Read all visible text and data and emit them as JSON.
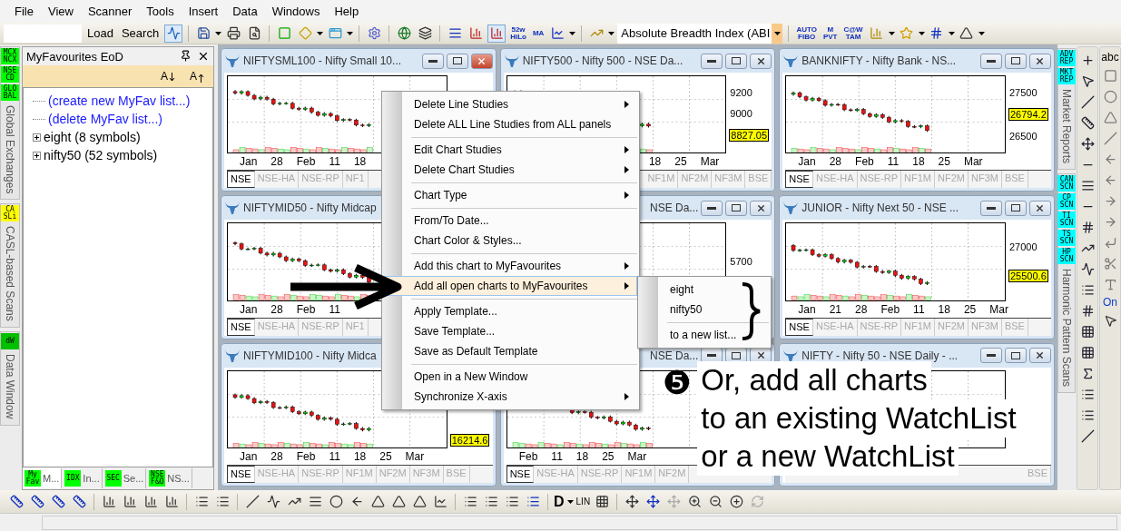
{
  "menu_bar": [
    "File",
    "View",
    "Scanner",
    "Tools",
    "Insert",
    "Data",
    "Windows",
    "Help"
  ],
  "toolbar": {
    "buttons": [
      "Load",
      "Search"
    ],
    "text_icons": [
      {
        "lines": [
          "52w",
          "HiLo"
        ]
      },
      {
        "lines": [
          "MA"
        ]
      },
      {
        "lines": [
          "AUTO",
          "FIBO"
        ]
      },
      {
        "lines": [
          "M",
          "PVT"
        ]
      },
      {
        "lines": [
          "C@W",
          "TAM"
        ]
      }
    ],
    "indicator": "Absolute Breadth Index (ABI"
  },
  "left_strip": [
    {
      "badges": [
        {
          "lines": [
            "MCX",
            "NCX"
          ],
          "color": "#00ff00"
        },
        {
          "lines": [
            "NSE",
            "CD"
          ],
          "color": "#00ff00"
        },
        {
          "lines": [
            "GLO",
            "BAL"
          ],
          "color": "#00ff00"
        }
      ],
      "label": "Global Exchanges"
    },
    {
      "badges": [
        {
          "lines": [
            "CA",
            "SLi"
          ],
          "color": "#ffff00"
        }
      ],
      "label": "CASL-based Scans"
    },
    {
      "badges": [
        {
          "lines": [
            "dW"
          ],
          "color": "#00c000"
        }
      ],
      "label": "Data Window"
    }
  ],
  "favourites_panel": {
    "title": "MyFavourites EoD",
    "sort_buttons": [
      "A",
      "A"
    ],
    "tree": [
      {
        "label": "(create new MyFav list...)",
        "kind": "link"
      },
      {
        "label": "(delete MyFav list...)",
        "kind": "link"
      },
      {
        "label": "eight (8 symbols)",
        "kind": "folder",
        "expanded": false
      },
      {
        "label": "nifty50 (52 symbols)",
        "kind": "folder",
        "expanded": false
      }
    ],
    "tabs": [
      {
        "badge": [
          "My",
          "Fav"
        ],
        "label": "M...",
        "selected": true
      },
      {
        "badge": [
          "IDX"
        ],
        "label": "In...",
        "selected": false
      },
      {
        "badge": [
          "SEC"
        ],
        "label": "Se...",
        "selected": false
      },
      {
        "badge": [
          "NSE",
          "F&O"
        ],
        "label": "NS...",
        "selected": false
      }
    ]
  },
  "charts": [
    {
      "title": "NIFTYSML100 - Nifty Small 10...",
      "active": true,
      "x_labels": [
        "Jan",
        "28",
        "Feb",
        "11",
        "18"
      ],
      "tabs": [
        {
          "label": "NSE",
          "selected": true
        },
        {
          "label": "NSE-HA",
          "selected": false
        },
        {
          "label": "NSE-RP",
          "selected": false
        },
        {
          "label": "NF1",
          "selected": false
        }
      ]
    },
    {
      "title": "NIFTY500 - Nifty 500 - NSE Da...",
      "active": false,
      "x_labels": [
        "18",
        "25",
        "Mar"
      ],
      "axis_cut_left": true,
      "y_labels": [
        {
          "text": "9200",
          "kind": "tick"
        },
        {
          "text": "9000",
          "kind": "tick"
        },
        {
          "text": "8827.05",
          "kind": "last"
        }
      ],
      "tabs": [
        {
          "label": "NF1M",
          "selected": false
        },
        {
          "label": "NF2M",
          "selected": false
        },
        {
          "label": "NF3M",
          "selected": false
        },
        {
          "label": "BSE",
          "selected": false
        }
      ],
      "tabs_cut_left": true
    },
    {
      "title": "BANKNIFTY - Nifty Bank - NS...",
      "active": false,
      "x_labels": [
        "Jan",
        "28",
        "Feb",
        "11",
        "18",
        "25",
        "Mar"
      ],
      "y_labels": [
        {
          "text": "27500",
          "kind": "tick"
        },
        {
          "text": "26794.2",
          "kind": "last"
        },
        {
          "text": "26500",
          "kind": "tick"
        }
      ],
      "tabs": [
        {
          "label": "NSE",
          "selected": true
        },
        {
          "label": "NSE-HA",
          "selected": false
        },
        {
          "label": "NSE-RP",
          "selected": false
        },
        {
          "label": "NF1M",
          "selected": false
        },
        {
          "label": "NF2M",
          "selected": false
        },
        {
          "label": "NF3M",
          "selected": false
        },
        {
          "label": "BSE",
          "selected": false
        }
      ]
    },
    {
      "title": "NIFTYMID50 - Nifty Midcap",
      "active": false,
      "x_labels": [
        "Jan",
        "28",
        "Feb",
        "11"
      ],
      "tabs": [
        {
          "label": "NSE",
          "selected": true
        },
        {
          "label": "NSE-HA",
          "selected": false
        },
        {
          "label": "NSE-RP",
          "selected": false
        },
        {
          "label": "NF1",
          "selected": false
        }
      ]
    },
    {
      "title": "NSE Da...",
      "title_cut_left": true,
      "active": false,
      "y_labels": [
        {
          "text": "5700",
          "kind": "tick"
        }
      ]
    },
    {
      "title": "JUNIOR - Nifty Next 50 - NSE ...",
      "active": false,
      "x_labels": [
        "Jan",
        "21",
        "28",
        "Feb",
        "11",
        "18",
        "25",
        "Mar"
      ],
      "y_labels": [
        {
          "text": "27000",
          "kind": "tick"
        },
        {
          "text": "25500.6",
          "kind": "last"
        }
      ],
      "tabs": [
        {
          "label": "NSE",
          "selected": true
        },
        {
          "label": "NSE-HA",
          "selected": false
        },
        {
          "label": "NSE-RP",
          "selected": false
        },
        {
          "label": "NF1M",
          "selected": false
        },
        {
          "label": "NF2M",
          "selected": false
        },
        {
          "label": "NF3M",
          "selected": false
        },
        {
          "label": "BSE",
          "selected": false
        }
      ]
    },
    {
      "title": "NIFTYMID100 - Nifty Midca",
      "active": false,
      "x_labels": [
        "Jan",
        "28",
        "Feb",
        "11",
        "18",
        "25",
        "Mar"
      ],
      "y_labels": [
        {
          "text": "16214.6",
          "kind": "last"
        }
      ],
      "tabs": [
        {
          "label": "NSE",
          "selected": true
        },
        {
          "label": "NSE-HA",
          "selected": false
        },
        {
          "label": "NSE-RP",
          "selected": false
        },
        {
          "label": "NF1M",
          "selected": false
        },
        {
          "label": "NF2M",
          "selected": false
        },
        {
          "label": "NF3M",
          "selected": false
        },
        {
          "label": "BSE",
          "selected": false
        }
      ]
    },
    {
      "title": "NSE Da...",
      "title_cut_left": true,
      "active": false,
      "x_labels": [
        "Feb",
        "11",
        "18",
        "25",
        "Mar"
      ],
      "tabs": [
        {
          "label": "NSE",
          "selected": true
        },
        {
          "label": "NSE-HA",
          "selected": false
        },
        {
          "label": "NSE-RP",
          "selected": false
        },
        {
          "label": "NF1M",
          "selected": false
        },
        {
          "label": "NF2M",
          "selected": false
        }
      ]
    },
    {
      "title": "NIFTY - Nifty 50 - NSE Daily - ...",
      "active": false,
      "tabs": [
        {
          "label": "BSE",
          "selected": false
        }
      ],
      "tabs_cut_left": true
    }
  ],
  "context_menu": [
    {
      "kind": "item",
      "label": "Delete Line Studies",
      "submenu": true,
      "selected": false
    },
    {
      "kind": "item",
      "label": "Delete ALL Line Studies from ALL panels",
      "submenu": false,
      "selected": false
    },
    {
      "kind": "separator"
    },
    {
      "kind": "item",
      "label": "Edit Chart Studies",
      "submenu": true,
      "selected": false
    },
    {
      "kind": "item",
      "label": "Delete Chart Studies",
      "submenu": true,
      "selected": false
    },
    {
      "kind": "separator"
    },
    {
      "kind": "item",
      "label": "Chart Type",
      "submenu": true,
      "selected": false
    },
    {
      "kind": "separator"
    },
    {
      "kind": "item",
      "label": "From/To Date...",
      "submenu": false,
      "selected": false
    },
    {
      "kind": "item",
      "label": "Chart Color & Styles...",
      "submenu": false,
      "selected": false
    },
    {
      "kind": "separator"
    },
    {
      "kind": "item",
      "label": "Add this chart to MyFavourites",
      "submenu": true,
      "selected": false
    },
    {
      "kind": "item",
      "label": "Add all open charts to MyFavourites",
      "submenu": true,
      "selected": true
    },
    {
      "kind": "separator"
    },
    {
      "kind": "item",
      "label": "Apply Template...",
      "submenu": false,
      "selected": false
    },
    {
      "kind": "item",
      "label": "Save Template...",
      "submenu": false,
      "selected": false
    },
    {
      "kind": "item",
      "label": "Save as Default Template",
      "submenu": false,
      "selected": false
    },
    {
      "kind": "separator"
    },
    {
      "kind": "item",
      "label": "Open in a New Window",
      "submenu": false,
      "selected": false
    },
    {
      "kind": "item",
      "label": "Synchronize X-axis",
      "submenu": true,
      "selected": false
    }
  ],
  "submenu": [
    {
      "kind": "item",
      "label": "eight",
      "selected": false
    },
    {
      "kind": "item",
      "label": "nifty50",
      "selected": false
    },
    {
      "kind": "separator"
    },
    {
      "kind": "item",
      "label": "to a new list...",
      "selected": false
    }
  ],
  "annotation": {
    "step": "❺",
    "lines": [
      "Or, add all charts",
      "to an existing WatchList",
      "or a new WatchList"
    ]
  },
  "right_strip": [
    {
      "badges": [
        {
          "lines": [
            "ADV",
            "REP"
          ],
          "color": "#00ffff"
        },
        {
          "lines": [
            "MKT",
            "REP"
          ],
          "color": "#00ffff"
        }
      ],
      "label": "Market Reports"
    },
    {
      "badges": [
        {
          "lines": [
            "CAN",
            "SCN"
          ],
          "color": "#00ffff"
        },
        {
          "lines": [
            "CP",
            "SCN"
          ],
          "color": "#00ffff"
        },
        {
          "lines": [
            "TI",
            "SCN"
          ],
          "color": "#00ffff"
        },
        {
          "lines": [
            "TS",
            "SCN"
          ],
          "color": "#00ffff"
        },
        {
          "lines": [
            "HP",
            "SCN"
          ],
          "color": "#00ffff"
        }
      ],
      "label": "Harmonic Pattern Scans"
    }
  ],
  "right_tools": {
    "text_tool": "abc",
    "on_label": "On"
  },
  "bottom_toolbar": {
    "period": "D",
    "scale": "LIN"
  }
}
